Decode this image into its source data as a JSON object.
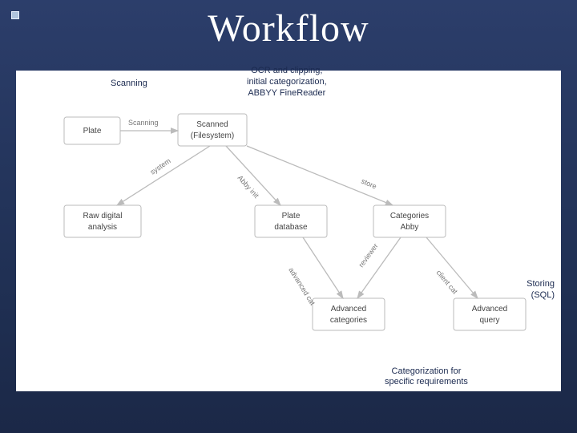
{
  "title": "Workflow",
  "captions": {
    "scanning": "Scanning",
    "ocr": "OCR and clipping,\ninitial categorization,\nABBYY FineReader",
    "storing": "Storing\n(SQL)",
    "categorize": "Categorization for\nspecific requirements"
  },
  "nodes": {
    "plate": {
      "l1": "Plate",
      "l2": ""
    },
    "scanned": {
      "l1": "Scanned",
      "l2": "(Filesystem)"
    },
    "raw": {
      "l1": "Raw digital",
      "l2": "analysis"
    },
    "db": {
      "l1": "Plate",
      "l2": "database"
    },
    "abby": {
      "l1": "Categories",
      "l2": "Abby"
    },
    "advcat": {
      "l1": "Advanced",
      "l2": "categories"
    },
    "query": {
      "l1": "Advanced",
      "l2": "query"
    }
  },
  "edges": {
    "e1": "Scanning",
    "e2": "Abby init",
    "e3": "system",
    "e4": "advanced cat",
    "e5": "reviewer",
    "e6": "client cat",
    "e7": "store"
  }
}
